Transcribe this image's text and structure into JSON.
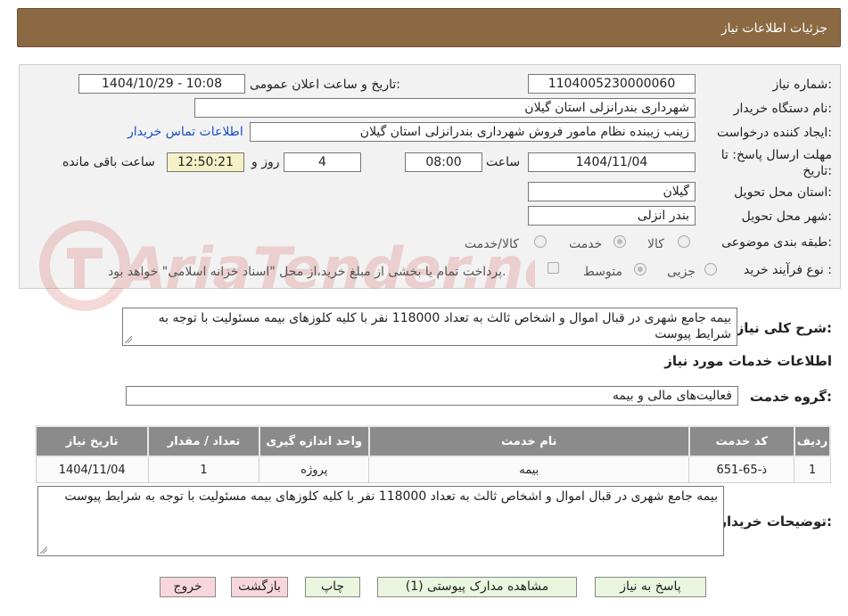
{
  "header": {
    "title": "جزئیات اطلاعات نیاز"
  },
  "form": {
    "need_number": {
      "label": "شماره نیاز:",
      "value": "1104005230000060"
    },
    "announce_datetime": {
      "label": "تاریخ و ساعت اعلان عمومی:",
      "value": "1404/10/29 - 10:08"
    },
    "buyer_org": {
      "label": "نام دستگاه خریدار:",
      "value": "شهرداری بندرانزلی استان گیلان"
    },
    "requester": {
      "label": "ایجاد کننده درخواست:",
      "value": "زینب زیبنده نظام مامور فروش شهرداری بندرانزلی استان گیلان"
    },
    "contact_link": "اطلاعات تماس خریدار",
    "deadline": {
      "label_line1": "مهلت ارسال پاسخ: تا",
      "label_line2": "تاریخ:",
      "date": "1404/11/04",
      "time_label": "ساعت",
      "time": "08:00",
      "days": "4",
      "days_label": "روز و",
      "remaining": "12:50:21",
      "remaining_label": "ساعت باقی مانده"
    },
    "delivery_province": {
      "label": "استان محل تحویل:",
      "value": "گیلان"
    },
    "delivery_city": {
      "label": "شهر محل تحویل:",
      "value": "بندر انزلی"
    },
    "category": {
      "label": "طبقه بندی موضوعی:",
      "options": [
        "کالا",
        "خدمت",
        "کالا/خدمت"
      ],
      "selected": "خدمت"
    },
    "purchase_type": {
      "label": "نوع فرآیند خرید :",
      "options": [
        "جزیی",
        "متوسط"
      ],
      "selected": "متوسط",
      "note": "پرداخت تمام یا بخشی از مبلغ خرید،از محل \"اسناد خزانه اسلامی\" خواهد بود."
    }
  },
  "summary": {
    "label": "شرح کلی نیاز:",
    "value": "بیمه جامع شهری در قبال اموال و اشخاص ثالث به تعداد 118000 نفر با کلیه کلوزهای بیمه مسئولیت با توجه به شرایط پیوست"
  },
  "services_section": {
    "title": "اطلاعات خدمات مورد نیاز",
    "group_label": "گروه خدمت:",
    "group_value": "فعالیت‌های مالی و بیمه"
  },
  "table": {
    "headers": [
      "ردیف",
      "کد خدمت",
      "نام خدمت",
      "واحد اندازه گیری",
      "تعداد / مقدار",
      "تاریخ نیاز"
    ],
    "rows": [
      [
        "1",
        "ذ-65-651",
        "بیمه",
        "پروژه",
        "1",
        "1404/11/04"
      ]
    ]
  },
  "buyer_notes": {
    "label": "توضیحات خریدار:",
    "value": "بیمه جامع شهری در قبال اموال و اشخاص ثالث به تعداد 118000 نفر با کلیه کلوزهای بیمه مسئولیت با توجه به شرایط پیوست"
  },
  "watermark": "AriaTender.neT",
  "buttons": {
    "reply": "پاسخ به نیاز",
    "attachments": "مشاهده مدارک پیوستی (1)",
    "print": "چاپ",
    "back": "بازگشت",
    "exit": "خروج"
  }
}
